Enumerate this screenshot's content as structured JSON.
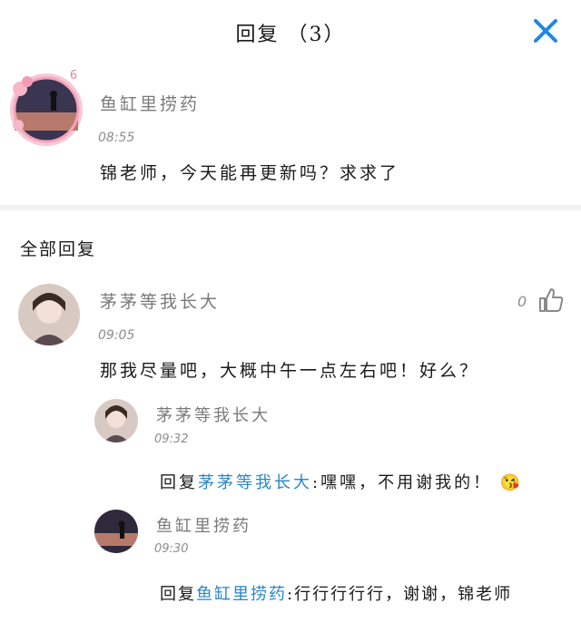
{
  "header": {
    "title": "回复 （3）"
  },
  "original_comment": {
    "author": "鱼缸里捞药",
    "level_badge": "6",
    "time": "08:55",
    "text": "锦老师，今天能再更新吗？求求了"
  },
  "section_title": "全部回复",
  "replies": [
    {
      "author": "茅茅等我长大",
      "time": "09:05",
      "text": "那我尽量吧，大概中午一点左右吧！好么？",
      "like_count": "0",
      "sub_replies": [
        {
          "author": "茅茅等我长大",
          "time": "09:32",
          "prefix": "回复",
          "mention": "茅茅等我长大",
          "text": ":嘿嘿，不用谢我的！",
          "emoji": "😘"
        },
        {
          "author": "鱼缸里捞药",
          "time": "09:30",
          "prefix": "回复",
          "mention": "鱼缸里捞药",
          "text": ":行行行行行，谢谢，锦老师"
        }
      ]
    }
  ],
  "colors": {
    "accent": "#2a86c8",
    "close_icon": "#1e88e5"
  },
  "icons": [
    "close-icon",
    "thumbs-up-icon",
    "level-badge-icon"
  ]
}
